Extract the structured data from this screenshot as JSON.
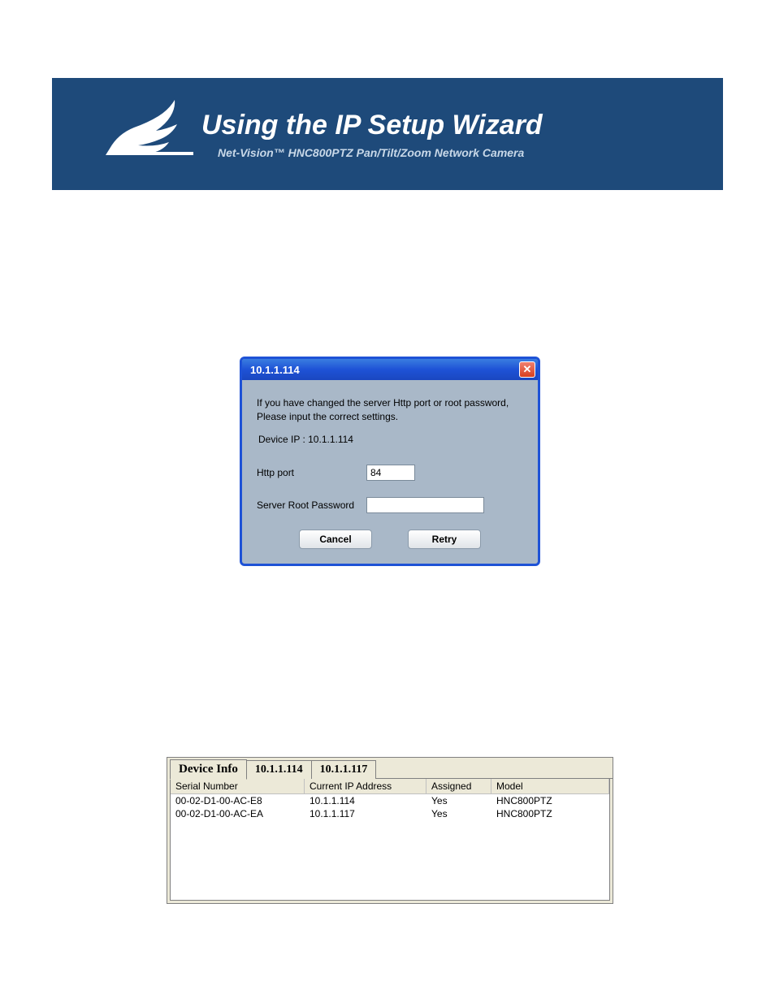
{
  "header": {
    "title": "Using the IP Setup Wizard",
    "subtitle": "Net-Vision™  HNC800PTZ Pan/Tilt/Zoom Network Camera"
  },
  "dialog": {
    "title": "10.1.1.114",
    "message": "If you have changed the server Http port or root password, Please input the correct settings.",
    "device_ip_label": "Device IP : 10.1.1.114",
    "http_port_label": "Http port",
    "http_port_value": "84",
    "password_label": "Server Root Password",
    "password_value": "",
    "cancel_label": "Cancel",
    "retry_label": "Retry"
  },
  "panel": {
    "tabs": [
      "Device Info",
      "10.1.1.114",
      "10.1.1.117"
    ],
    "columns": {
      "serial": "Serial Number",
      "ip": "Current IP Address",
      "assigned": "Assigned",
      "model": "Model"
    },
    "rows": [
      {
        "serial": "00-02-D1-00-AC-E8",
        "ip": "10.1.1.114",
        "assigned": "Yes",
        "model": "HNC800PTZ"
      },
      {
        "serial": "00-02-D1-00-AC-EA",
        "ip": "10.1.1.117",
        "assigned": "Yes",
        "model": "HNC800PTZ"
      }
    ]
  }
}
